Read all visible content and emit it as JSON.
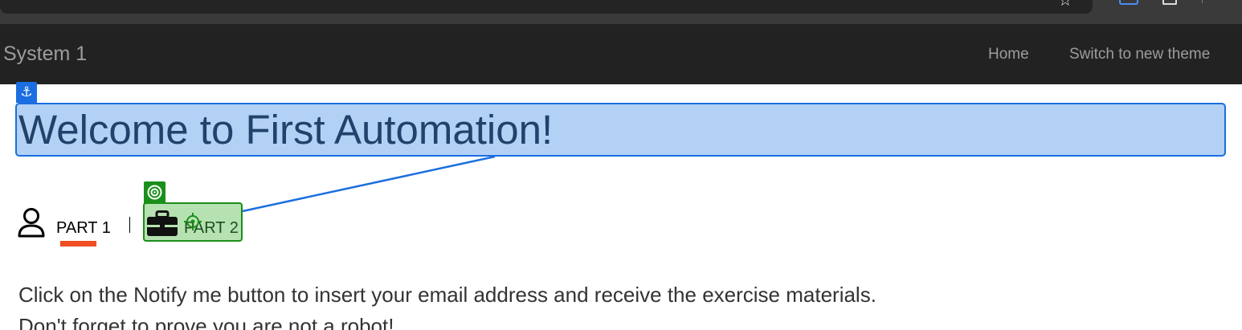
{
  "navbar": {
    "brand": "System 1",
    "links": [
      {
        "label": "Home"
      },
      {
        "label": "Switch to new theme"
      }
    ]
  },
  "main": {
    "title": "Welcome to First Automation!",
    "tabs": [
      {
        "label": "PART 1",
        "icon": "user-icon",
        "active": true
      },
      {
        "label": "PART 2",
        "icon": "briefcase-icon",
        "active": false
      }
    ],
    "instructions": [
      "Click on the Notify me button to insert your email address and receive the exercise materials.",
      "Don't forget to prove you are not a robot!"
    ]
  },
  "colors": {
    "navbar_bg": "#222222",
    "accent_underline": "#f04e23",
    "selection_blue": "#1b6ee0",
    "selection_green": "#1a8f1a"
  }
}
